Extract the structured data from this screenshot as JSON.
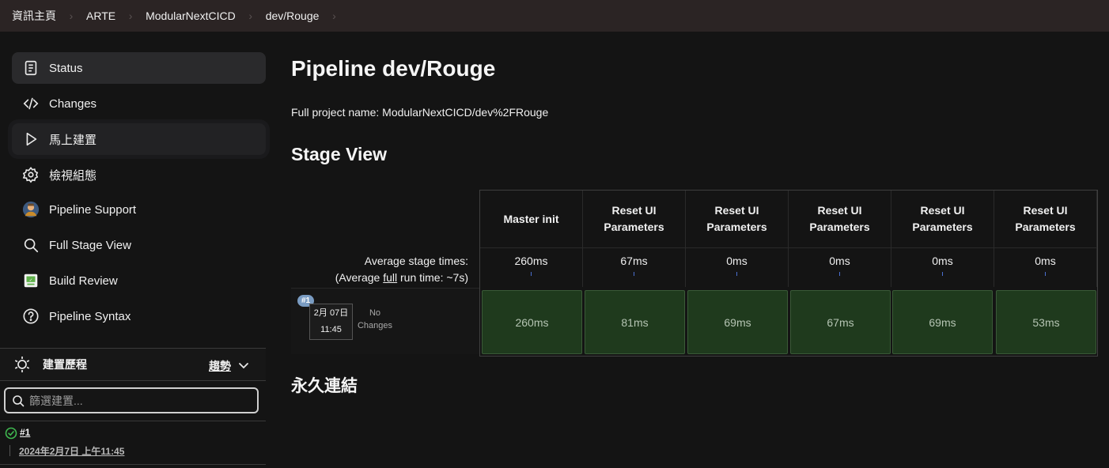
{
  "breadcrumb": [
    "資訊主頁",
    "ARTE",
    "ModularNextCICD",
    "dev/Rouge"
  ],
  "sidebar": {
    "items": [
      {
        "label": "Status",
        "icon": "document-icon"
      },
      {
        "label": "Changes",
        "icon": "code-icon"
      },
      {
        "label": "馬上建置",
        "icon": "play-icon"
      },
      {
        "label": "檢視組態",
        "icon": "gear-icon"
      },
      {
        "label": "Pipeline Support",
        "icon": "user-avatar-icon"
      },
      {
        "label": "Full Stage View",
        "icon": "search-icon"
      },
      {
        "label": "Build Review",
        "icon": "build-review-icon"
      },
      {
        "label": "Pipeline Syntax",
        "icon": "help-icon"
      }
    ],
    "history": {
      "title": "建置歷程",
      "trend_label": "趨勢",
      "filter_placeholder": "篩選建置...",
      "builds": [
        {
          "number": "#1",
          "date": "2024年2月7日 上午11:45",
          "status": "success"
        }
      ]
    }
  },
  "main": {
    "title": "Pipeline dev/Rouge",
    "full_name": "Full project name: ModularNextCICD/dev%2FRouge",
    "stage_view_title": "Stage View",
    "permalinks_title": "永久連結",
    "avg_label_line1": "Average stage times:",
    "avg_label_prefix": "(Average ",
    "avg_label_link": "full",
    "avg_label_suffix": " run time: ~7s)",
    "stages": [
      {
        "name_line1": "Master init",
        "name_line2": "",
        "avg": "260ms",
        "run": "260ms"
      },
      {
        "name_line1": "Reset UI",
        "name_line2": "Parameters",
        "avg": "67ms",
        "run": "81ms"
      },
      {
        "name_line1": "Reset UI",
        "name_line2": "Parameters",
        "avg": "0ms",
        "run": "69ms"
      },
      {
        "name_line1": "Reset UI",
        "name_line2": "Parameters",
        "avg": "0ms",
        "run": "67ms"
      },
      {
        "name_line1": "Reset UI",
        "name_line2": "Parameters",
        "avg": "0ms",
        "run": "69ms"
      },
      {
        "name_line1": "Reset UI",
        "name_line2": "Parameters",
        "avg": "0ms",
        "run": "53ms"
      }
    ],
    "run": {
      "badge": "#1",
      "date": "2月 07日",
      "time": "11:45",
      "changes_line1": "No",
      "changes_line2": "Changes"
    }
  },
  "colors": {
    "success_cell": "#1f3a1d",
    "badge": "#7a9cc2",
    "topbar": "#2b2424"
  }
}
